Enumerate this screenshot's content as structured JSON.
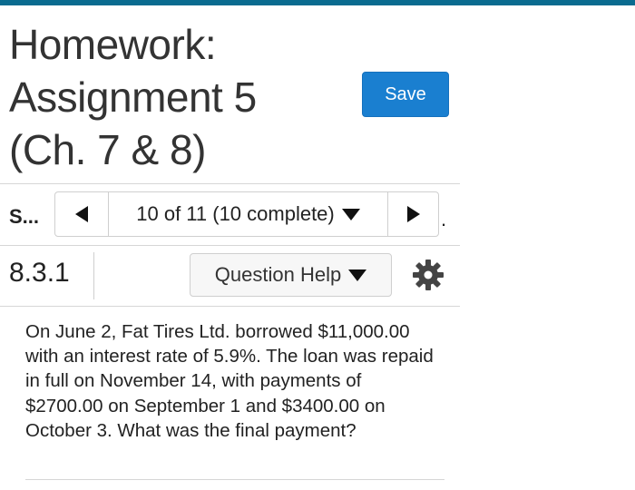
{
  "title": {
    "line1": "Homework:",
    "line2": "Assignment 5",
    "line3": "(Ch. 7 & 8)"
  },
  "save_button": {
    "label": "Save"
  },
  "navigator": {
    "section_label": "S...",
    "progress_text": "10 of 11 (10 complete)",
    "trailing_dot": ".",
    "icons": {
      "prev": "left-triangle",
      "next": "right-triangle",
      "dropdown": "down-triangle"
    }
  },
  "question": {
    "number": "8.3.1",
    "help_label": "Question Help",
    "settings_icon": "gear-icon",
    "text": "On June 2, Fat Tires Ltd. borrowed $11,000.00 with an interest rate of 5.9%. The loan was repaid in full on November 14, with payments of $2700.00 on September 1 and $3400.00 on October 3. What was the final payment?"
  },
  "colors": {
    "accent_bar": "#0a6b8f",
    "save_button": "#1a7fd0",
    "border": "#cfcfcf"
  }
}
